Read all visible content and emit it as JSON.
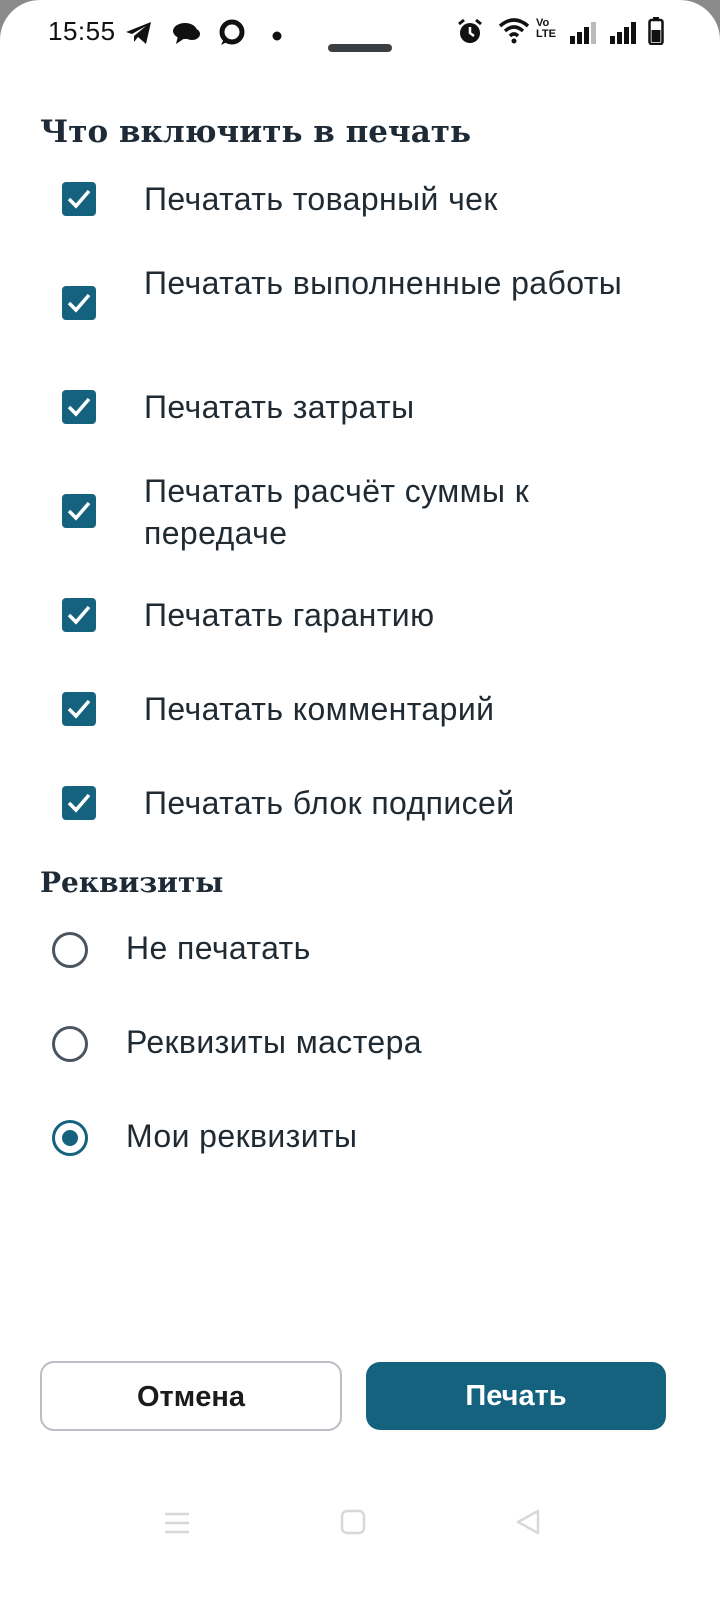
{
  "status_bar": {
    "time": "15:55",
    "left_icons": [
      "telegram-icon",
      "chat-bubbles-icon",
      "messenger-icon",
      "dot-icon"
    ],
    "right_icons": [
      "alarm-icon",
      "wifi-icon",
      "volte-icon",
      "signal-icon",
      "signal-icon",
      "battery-icon"
    ],
    "volte_text": "Vo LTE"
  },
  "print_section": {
    "title": "Что включить в печать",
    "options": [
      {
        "label": "Печатать товарный чек",
        "checked": true
      },
      {
        "label": "Печатать выполненные работы",
        "checked": true
      },
      {
        "label": "Печатать затраты",
        "checked": true
      },
      {
        "label": "Печатать расчёт суммы к передаче",
        "checked": true
      },
      {
        "label": "Печатать гарантию",
        "checked": true
      },
      {
        "label": "Печатать комментарий",
        "checked": true
      },
      {
        "label": "Печатать блок подписей",
        "checked": true
      }
    ]
  },
  "requisites_section": {
    "title": "Реквизиты",
    "options": [
      {
        "label": "Не печатать",
        "selected": false
      },
      {
        "label": "Реквизиты мастера",
        "selected": false
      },
      {
        "label": "Мои реквизиты",
        "selected": true
      }
    ]
  },
  "buttons": {
    "cancel": "Отмена",
    "print": "Печать"
  },
  "colors": {
    "accent": "#14627e",
    "text": "#1f2a33",
    "radio_border": "#4a5560"
  },
  "nav_bar": {
    "icons": [
      "menu-icon",
      "home-square-icon",
      "back-triangle-icon"
    ]
  }
}
